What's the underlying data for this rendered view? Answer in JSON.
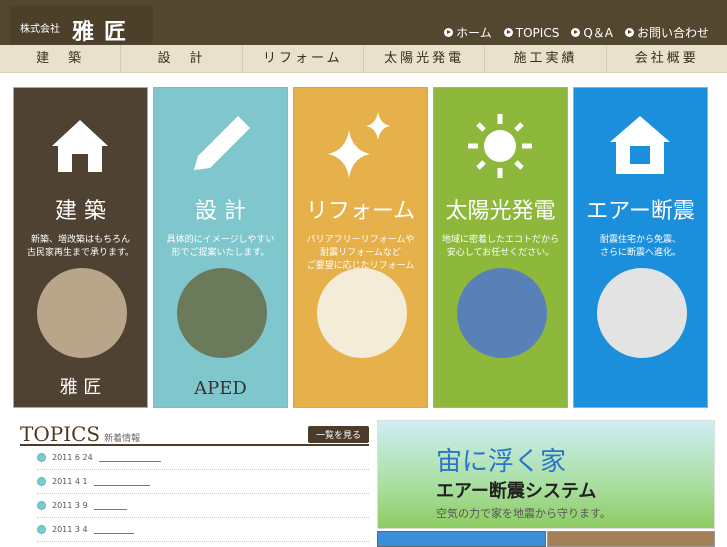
{
  "header": {
    "company_prefix": "株式会社",
    "company_name": "雅匠",
    "links": [
      "ホーム",
      "TOPICS",
      "Q＆A",
      "お問い合わせ"
    ]
  },
  "nav": [
    "建　築",
    "設　計",
    "リフォーム",
    "太陽光発電",
    "施工実績",
    "会社概要"
  ],
  "cards": [
    {
      "title": "建 築",
      "desc": "新築、増改築はもちろん\n古民家再生まで承ります。",
      "brand": "雅 匠",
      "color": "#4f4232"
    },
    {
      "title": "設 計",
      "desc": "具体的にイメージしやすい\n形でご提案いたします。",
      "brand": "APED",
      "color": "#80c7cd"
    },
    {
      "title": "リフォーム",
      "desc": "バリアフリーリフォームや\n耐震リフォームなど\nご要望に応じたリフォーム",
      "brand": "",
      "color": "#e6b14a"
    },
    {
      "title": "太陽光発電",
      "desc": "地域に密着したエコトだから\n安心してお任せください。",
      "brand": "",
      "color": "#8db83b"
    },
    {
      "title": "エアー断震",
      "desc": "耐震住宅から免震、\nさらに断震へ進化。",
      "brand": "",
      "color": "#1b8fdc"
    }
  ],
  "topics": {
    "title": "TOPICS",
    "subtitle": "新着情報",
    "more": "一覧を見る",
    "items": [
      "2011 6 24",
      "2011 4 1",
      "2011 3 9",
      "2011 3 4"
    ]
  },
  "banner": {
    "line1": "宙に浮く家",
    "line2": "エアー断震システム",
    "line3": "空気の力で家を地震から守ります。"
  }
}
